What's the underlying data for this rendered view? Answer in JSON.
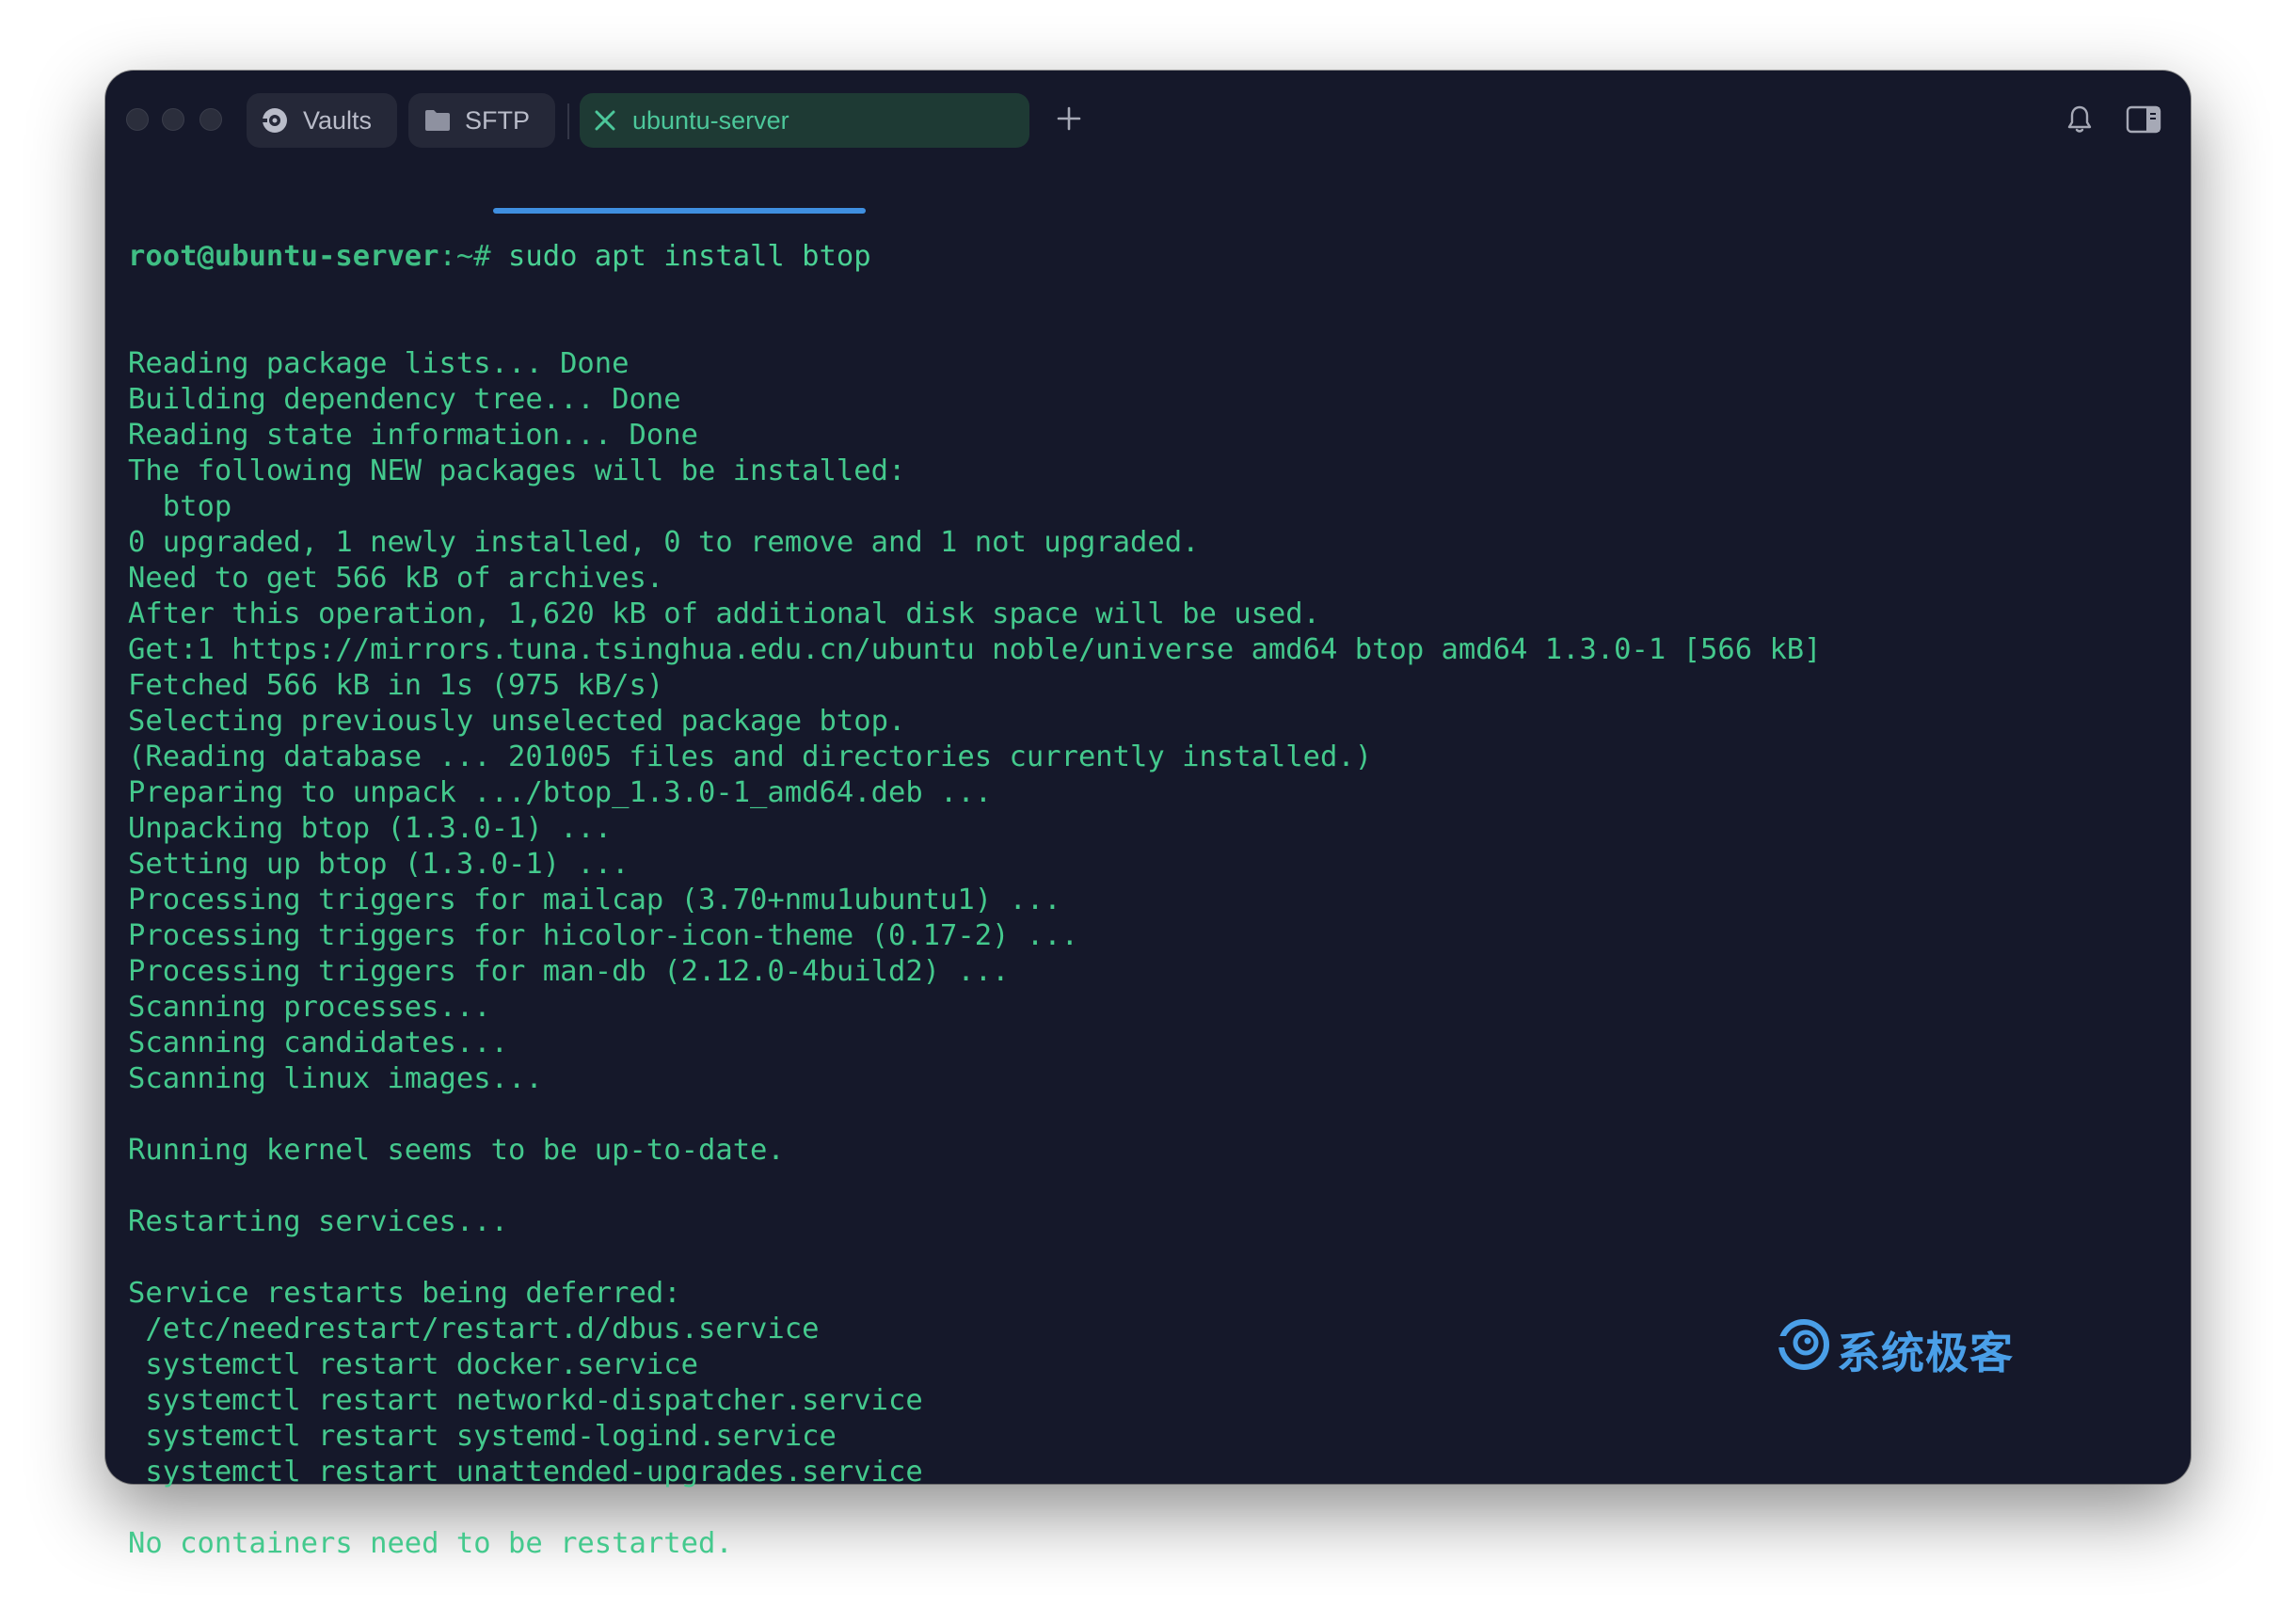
{
  "window": {
    "tabs": [
      {
        "label": "Vaults",
        "icon": "vault-icon"
      },
      {
        "label": "SFTP",
        "icon": "folder-icon"
      },
      {
        "label": "ubuntu-server",
        "icon": "close-icon",
        "active": true
      }
    ],
    "new_tab_icon": "plus-icon",
    "notifications_icon": "bell-icon",
    "sidebar_toggle_icon": "panel-icon"
  },
  "terminal": {
    "prompt_user_host": "root@ubuntu-server",
    "prompt_path": ":~# ",
    "command": "sudo apt install btop",
    "lines": [
      "Reading package lists... Done",
      "Building dependency tree... Done",
      "Reading state information... Done",
      "The following NEW packages will be installed:",
      "  btop",
      "0 upgraded, 1 newly installed, 0 to remove and 1 not upgraded.",
      "Need to get 566 kB of archives.",
      "After this operation, 1,620 kB of additional disk space will be used.",
      "Get:1 https://mirrors.tuna.tsinghua.edu.cn/ubuntu noble/universe amd64 btop amd64 1.3.0-1 [566 kB]",
      "Fetched 566 kB in 1s (975 kB/s)",
      "Selecting previously unselected package btop.",
      "(Reading database ... 201005 files and directories currently installed.)",
      "Preparing to unpack .../btop_1.3.0-1_amd64.deb ...",
      "Unpacking btop (1.3.0-1) ...",
      "Setting up btop (1.3.0-1) ...",
      "Processing triggers for mailcap (3.70+nmu1ubuntu1) ...",
      "Processing triggers for hicolor-icon-theme (0.17-2) ...",
      "Processing triggers for man-db (2.12.0-4build2) ...",
      "Scanning processes...",
      "Scanning candidates...",
      "Scanning linux images...",
      "",
      "Running kernel seems to be up-to-date.",
      "",
      "Restarting services...",
      "",
      "Service restarts being deferred:",
      " /etc/needrestart/restart.d/dbus.service",
      " systemctl restart docker.service",
      " systemctl restart networkd-dispatcher.service",
      " systemctl restart systemd-logind.service",
      " systemctl restart unattended-upgrades.service",
      "",
      "No containers need to be restarted."
    ]
  },
  "watermark": {
    "text": "系统极客"
  },
  "colors": {
    "background": "#15182a",
    "terminal_text": "#44c98d",
    "active_tab": "#1e3a34",
    "accent_underline": "#3f8fe0",
    "watermark": "#4a9fe8"
  }
}
